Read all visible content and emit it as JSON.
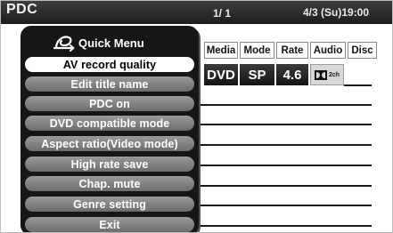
{
  "header": {
    "app_title": "PDC",
    "page_indicator": "1/ 1",
    "date_time": "4/3 (Su)19:00"
  },
  "columns": [
    {
      "label": "Media"
    },
    {
      "label": "Mode"
    },
    {
      "label": "Rate"
    },
    {
      "label": "Audio"
    },
    {
      "label": "Disc"
    }
  ],
  "current_entry": {
    "media": "DVD",
    "mode": "SP",
    "rate": "4.6",
    "audio_icon": "dolby-digital-icon",
    "audio_channels": "2ch"
  },
  "quick_menu": {
    "title": "Quick Menu",
    "icon": "quick-menu-icon",
    "items": [
      {
        "label": "AV record quality",
        "selected": true
      },
      {
        "label": "Edit title name",
        "selected": false
      },
      {
        "label": "PDC on",
        "selected": false
      },
      {
        "label": "DVD compatible mode",
        "selected": false
      },
      {
        "label": "Aspect ratio(Video mode)",
        "selected": false
      },
      {
        "label": "High rate save",
        "selected": false
      },
      {
        "label": "Chap. mute",
        "selected": false
      },
      {
        "label": "Genre setting",
        "selected": false
      },
      {
        "label": "Exit",
        "selected": false
      }
    ]
  },
  "colors": {
    "panel": "#161616",
    "item_bg": "#8a8a8a",
    "item_selected_bg": "#ffffff",
    "header_bg": "#2a2a2a"
  }
}
